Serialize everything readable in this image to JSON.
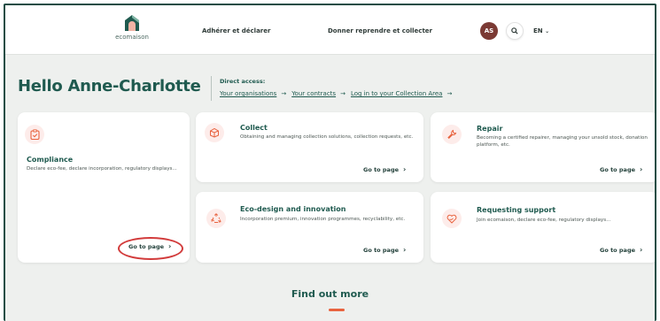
{
  "header": {
    "logo_text": "ecomaison",
    "nav": [
      "Adhérer et déclarer",
      "Donner reprendre et collecter"
    ],
    "avatar_initials": "AS",
    "language": "EN"
  },
  "greeting": "Hello Anne-Charlotte",
  "direct_access": {
    "label": "Direct access:",
    "links": [
      "Your organisations",
      "Your contracts",
      "Log in to your Collection Area"
    ]
  },
  "cards": [
    {
      "title": "Compliance",
      "description": "Declare eco-fee, declare incorporation, regulatory displays...",
      "cta": "Go to page",
      "icon": "clipboard-check-icon"
    },
    {
      "title": "Collect",
      "description": "Obtaining and managing collection solutions, collection requests, etc.",
      "cta": "Go to page",
      "icon": "box-icon"
    },
    {
      "title": "Repair",
      "description": "Becoming a certified repairer, managing your unsold stock, donation platform, etc.",
      "cta": "Go to page",
      "icon": "wrench-icon"
    },
    {
      "title": "Eco-design and innovation",
      "description": "Incorporation premium, innovation programmes, recyclability, etc.",
      "cta": "Go to page",
      "icon": "recycle-icon"
    },
    {
      "title": "Requesting support",
      "description": "Join ecomaison, declare eco-fee, regulatory displays...",
      "cta": "Go to page",
      "icon": "heart-hand-icon"
    }
  ],
  "find_out_more": "Find out more",
  "colors": {
    "brand": "#1f5a4f",
    "accent": "#e8633f",
    "highlight": "#d23b3b",
    "avatar": "#7b3a34"
  }
}
